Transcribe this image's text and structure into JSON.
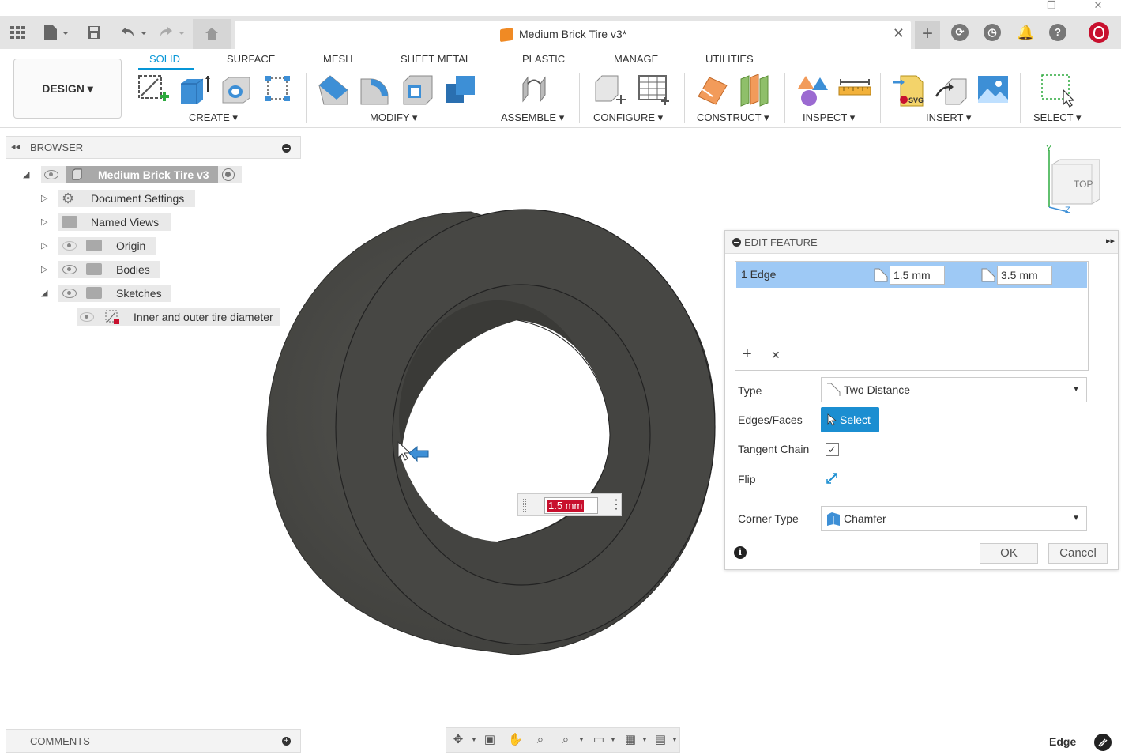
{
  "window": {
    "minimize": "—",
    "maximize": "❐",
    "close": "✕"
  },
  "tabbar": {
    "doc_title": "Medium Brick Tire v3*",
    "close": "✕",
    "new_tab": "+"
  },
  "toolbar": {
    "design_label": "DESIGN ▾",
    "tabs": [
      "SOLID",
      "SURFACE",
      "MESH",
      "SHEET METAL",
      "PLASTIC",
      "MANAGE",
      "UTILITIES"
    ],
    "groups": [
      "CREATE ▾",
      "MODIFY ▾",
      "ASSEMBLE ▾",
      "CONFIGURE ▾",
      "CONSTRUCT ▾",
      "INSPECT ▾",
      "INSERT ▾",
      "SELECT ▾"
    ]
  },
  "browser": {
    "title": "BROWSER",
    "root": "Medium Brick Tire v3",
    "items": [
      "Document Settings",
      "Named Views",
      "Origin",
      "Bodies",
      "Sketches"
    ],
    "sketch_child": "Inner and outer tire diameter"
  },
  "viewcube": {
    "face_label": "TOP",
    "axis_y": "Y",
    "axis_z": "Z"
  },
  "edit_feature": {
    "title": "EDIT FEATURE",
    "row_label": "1 Edge",
    "distance_1": "1.5 mm",
    "distance_2": "3.5 mm",
    "add": "+",
    "remove": "✕",
    "type_label": "Type",
    "type_value": "Two Distance",
    "edges_label": "Edges/Faces",
    "select_label": "Select",
    "tangent_label": "Tangent Chain",
    "tangent_checked": "✓",
    "flip_label": "Flip",
    "corner_label": "Corner Type",
    "corner_value": "Chamfer",
    "ok": "OK",
    "cancel": "Cancel"
  },
  "viewport": {
    "dimension_value": "1.5 mm"
  },
  "comments": {
    "title": "COMMENTS"
  },
  "status": {
    "selection": "Edge"
  },
  "colors": {
    "accent": "#0696d7",
    "select_blue": "#1b8ed1",
    "row_highlight": "#9ec9f5",
    "tire": "#4a4a47"
  }
}
